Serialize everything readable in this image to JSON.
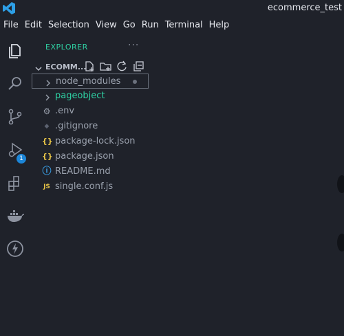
{
  "window": {
    "title": "ecommerce_test"
  },
  "menu": [
    "File",
    "Edit",
    "Selection",
    "View",
    "Go",
    "Run",
    "Terminal",
    "Help"
  ],
  "activity_bar": {
    "icons": [
      "explorer-icon",
      "search-icon",
      "source-control-icon",
      "run-debug-icon",
      "extensions-icon",
      "docker-icon",
      "thunder-client-icon"
    ],
    "source_control_badge": "1"
  },
  "explorer": {
    "header": "EXPLORER",
    "more": "···",
    "section_title": "ECOMM...",
    "items": [
      {
        "label": "node_modules",
        "type": "folder",
        "icon": "chevron-right-icon"
      },
      {
        "label": "pageobject",
        "type": "folder",
        "icon": "chevron-right-icon"
      },
      {
        "label": ".env",
        "type": "file",
        "glyph": "⚙"
      },
      {
        "label": ".gitignore",
        "type": "file",
        "glyph": "◆"
      },
      {
        "label": "package-lock.json",
        "type": "file",
        "glyph": "{}"
      },
      {
        "label": "package.json",
        "type": "file",
        "glyph": "{}"
      },
      {
        "label": "README.md",
        "type": "file",
        "glyph": "ⓘ"
      },
      {
        "label": "single.conf.js",
        "type": "file",
        "glyph": "JS"
      }
    ]
  },
  "colors": {
    "background": "#1f222a",
    "accent": "#2fd3a5",
    "badge": "#1c86d8",
    "json_icon": "#e8c547",
    "js_icon": "#e8c547",
    "info_icon": "#3aa0e8"
  }
}
